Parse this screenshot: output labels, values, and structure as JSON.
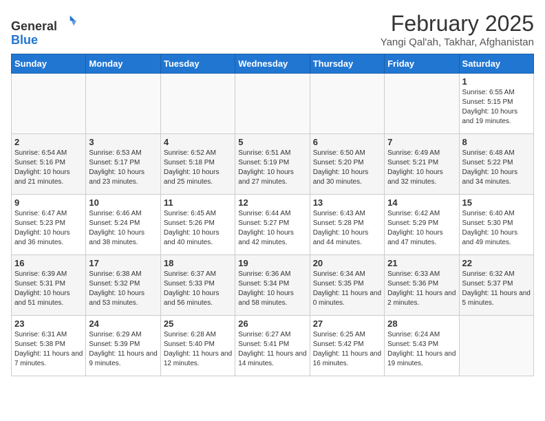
{
  "header": {
    "logo_general": "General",
    "logo_blue": "Blue",
    "title": "February 2025",
    "subtitle": "Yangi Qal'ah, Takhar, Afghanistan"
  },
  "days_of_week": [
    "Sunday",
    "Monday",
    "Tuesday",
    "Wednesday",
    "Thursday",
    "Friday",
    "Saturday"
  ],
  "weeks": [
    [
      {
        "day": "",
        "info": ""
      },
      {
        "day": "",
        "info": ""
      },
      {
        "day": "",
        "info": ""
      },
      {
        "day": "",
        "info": ""
      },
      {
        "day": "",
        "info": ""
      },
      {
        "day": "",
        "info": ""
      },
      {
        "day": "1",
        "info": "Sunrise: 6:55 AM\nSunset: 5:15 PM\nDaylight: 10 hours and 19 minutes."
      }
    ],
    [
      {
        "day": "2",
        "info": "Sunrise: 6:54 AM\nSunset: 5:16 PM\nDaylight: 10 hours and 21 minutes."
      },
      {
        "day": "3",
        "info": "Sunrise: 6:53 AM\nSunset: 5:17 PM\nDaylight: 10 hours and 23 minutes."
      },
      {
        "day": "4",
        "info": "Sunrise: 6:52 AM\nSunset: 5:18 PM\nDaylight: 10 hours and 25 minutes."
      },
      {
        "day": "5",
        "info": "Sunrise: 6:51 AM\nSunset: 5:19 PM\nDaylight: 10 hours and 27 minutes."
      },
      {
        "day": "6",
        "info": "Sunrise: 6:50 AM\nSunset: 5:20 PM\nDaylight: 10 hours and 30 minutes."
      },
      {
        "day": "7",
        "info": "Sunrise: 6:49 AM\nSunset: 5:21 PM\nDaylight: 10 hours and 32 minutes."
      },
      {
        "day": "8",
        "info": "Sunrise: 6:48 AM\nSunset: 5:22 PM\nDaylight: 10 hours and 34 minutes."
      }
    ],
    [
      {
        "day": "9",
        "info": "Sunrise: 6:47 AM\nSunset: 5:23 PM\nDaylight: 10 hours and 36 minutes."
      },
      {
        "day": "10",
        "info": "Sunrise: 6:46 AM\nSunset: 5:24 PM\nDaylight: 10 hours and 38 minutes."
      },
      {
        "day": "11",
        "info": "Sunrise: 6:45 AM\nSunset: 5:26 PM\nDaylight: 10 hours and 40 minutes."
      },
      {
        "day": "12",
        "info": "Sunrise: 6:44 AM\nSunset: 5:27 PM\nDaylight: 10 hours and 42 minutes."
      },
      {
        "day": "13",
        "info": "Sunrise: 6:43 AM\nSunset: 5:28 PM\nDaylight: 10 hours and 44 minutes."
      },
      {
        "day": "14",
        "info": "Sunrise: 6:42 AM\nSunset: 5:29 PM\nDaylight: 10 hours and 47 minutes."
      },
      {
        "day": "15",
        "info": "Sunrise: 6:40 AM\nSunset: 5:30 PM\nDaylight: 10 hours and 49 minutes."
      }
    ],
    [
      {
        "day": "16",
        "info": "Sunrise: 6:39 AM\nSunset: 5:31 PM\nDaylight: 10 hours and 51 minutes."
      },
      {
        "day": "17",
        "info": "Sunrise: 6:38 AM\nSunset: 5:32 PM\nDaylight: 10 hours and 53 minutes."
      },
      {
        "day": "18",
        "info": "Sunrise: 6:37 AM\nSunset: 5:33 PM\nDaylight: 10 hours and 56 minutes."
      },
      {
        "day": "19",
        "info": "Sunrise: 6:36 AM\nSunset: 5:34 PM\nDaylight: 10 hours and 58 minutes."
      },
      {
        "day": "20",
        "info": "Sunrise: 6:34 AM\nSunset: 5:35 PM\nDaylight: 11 hours and 0 minutes."
      },
      {
        "day": "21",
        "info": "Sunrise: 6:33 AM\nSunset: 5:36 PM\nDaylight: 11 hours and 2 minutes."
      },
      {
        "day": "22",
        "info": "Sunrise: 6:32 AM\nSunset: 5:37 PM\nDaylight: 11 hours and 5 minutes."
      }
    ],
    [
      {
        "day": "23",
        "info": "Sunrise: 6:31 AM\nSunset: 5:38 PM\nDaylight: 11 hours and 7 minutes."
      },
      {
        "day": "24",
        "info": "Sunrise: 6:29 AM\nSunset: 5:39 PM\nDaylight: 11 hours and 9 minutes."
      },
      {
        "day": "25",
        "info": "Sunrise: 6:28 AM\nSunset: 5:40 PM\nDaylight: 11 hours and 12 minutes."
      },
      {
        "day": "26",
        "info": "Sunrise: 6:27 AM\nSunset: 5:41 PM\nDaylight: 11 hours and 14 minutes."
      },
      {
        "day": "27",
        "info": "Sunrise: 6:25 AM\nSunset: 5:42 PM\nDaylight: 11 hours and 16 minutes."
      },
      {
        "day": "28",
        "info": "Sunrise: 6:24 AM\nSunset: 5:43 PM\nDaylight: 11 hours and 19 minutes."
      },
      {
        "day": "",
        "info": ""
      }
    ]
  ]
}
